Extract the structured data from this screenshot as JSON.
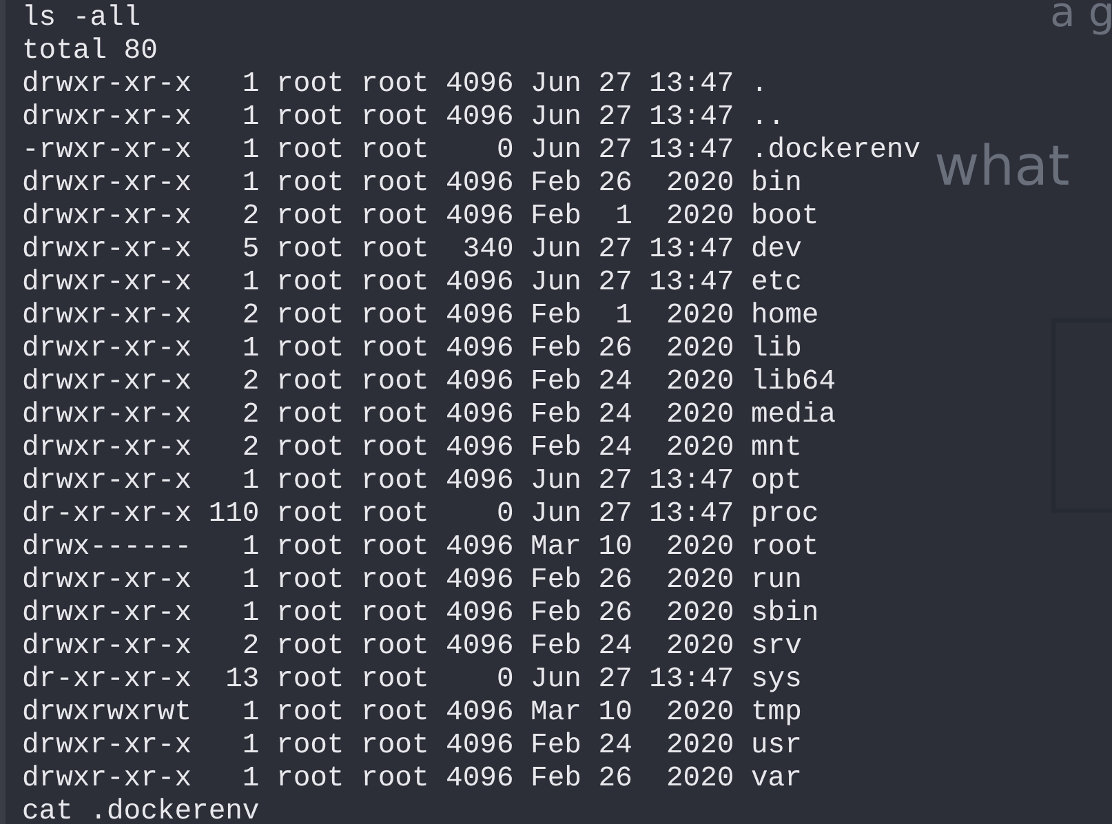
{
  "terminal": {
    "lines": [
      "ls -all",
      "total 80",
      "drwxr-xr-x   1 root root 4096 Jun 27 13:47 .",
      "drwxr-xr-x   1 root root 4096 Jun 27 13:47 ..",
      "-rwxr-xr-x   1 root root    0 Jun 27 13:47 .dockerenv",
      "drwxr-xr-x   1 root root 4096 Feb 26  2020 bin",
      "drwxr-xr-x   2 root root 4096 Feb  1  2020 boot",
      "drwxr-xr-x   5 root root  340 Jun 27 13:47 dev",
      "drwxr-xr-x   1 root root 4096 Jun 27 13:47 etc",
      "drwxr-xr-x   2 root root 4096 Feb  1  2020 home",
      "drwxr-xr-x   1 root root 4096 Feb 26  2020 lib",
      "drwxr-xr-x   2 root root 4096 Feb 24  2020 lib64",
      "drwxr-xr-x   2 root root 4096 Feb 24  2020 media",
      "drwxr-xr-x   2 root root 4096 Feb 24  2020 mnt",
      "drwxr-xr-x   1 root root 4096 Jun 27 13:47 opt",
      "dr-xr-xr-x 110 root root    0 Jun 27 13:47 proc",
      "drwx------   1 root root 4096 Mar 10  2020 root",
      "drwxr-xr-x   1 root root 4096 Feb 26  2020 run",
      "drwxr-xr-x   1 root root 4096 Feb 26  2020 sbin",
      "drwxr-xr-x   2 root root 4096 Feb 24  2020 srv",
      "dr-xr-xr-x  13 root root    0 Jun 27 13:47 sys",
      "drwxrwxrwt   1 root root 4096 Mar 10  2020 tmp",
      "drwxr-xr-x   1 root root 4096 Feb 24  2020 usr",
      "drwxr-xr-x   1 root root 4096 Feb 26  2020 var",
      "cat .dockerenv"
    ]
  },
  "background_sketch": {
    "texts": [
      "a g",
      "what"
    ]
  }
}
